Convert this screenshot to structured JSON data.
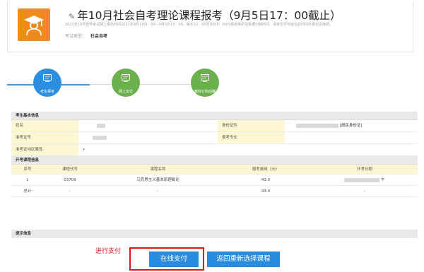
{
  "header": {
    "title": "年10月社会自考理论课程报考（9月5日17：00截止）",
    "description": "2021年10月自学考试网上报名时间2021年9月1日9：00—9月5日17：00。每天22：00至次日8：00为系统维护及数据归档时间，请考生尽可能在此时间外报名及缴费。",
    "exam_type_label": "考试类型：",
    "exam_type_value": "社会自考",
    "logo_color": "#f08a1c"
  },
  "steps": [
    {
      "label": "考生报考",
      "icon": "form-icon",
      "color": "#2d8ee0",
      "state": "active"
    },
    {
      "label": "网上支付",
      "icon": "form-icon",
      "color": "#6ab04c",
      "state": "pending"
    },
    {
      "label": "教材订购前确",
      "icon": "form-icon",
      "color": "#6ab04c",
      "state": "pending"
    }
  ],
  "basic_info": {
    "section_title": "考生基本信息",
    "name_label": "姓名",
    "id_label": "身份证件",
    "id_type": "[居民身份证]",
    "admission_label": "准考证号",
    "major_label": "报考专业",
    "region_label": "准考证地区属性",
    "region_value": "•"
  },
  "courses": {
    "section_title": "开考课程信息",
    "headers": [
      "序号",
      "课程代号",
      "课程名称",
      "报考费用（元）",
      "开考日期"
    ],
    "rows": [
      {
        "index": "1",
        "code": "03709",
        "name": "马克思主义基本原理概论",
        "fee": "43.0",
        "date": "午"
      },
      {
        "index": "总计",
        "code": "-",
        "name": "-",
        "fee": "43.0",
        "date": "-"
      }
    ]
  },
  "hint": {
    "section_title": "提示信息"
  },
  "annotation": "进行支付",
  "actions": {
    "pay_label": "在线支付",
    "back_label": "返回重新选择课程",
    "button_color": "#2a8ce0",
    "highlight_color": "#e3141b"
  }
}
